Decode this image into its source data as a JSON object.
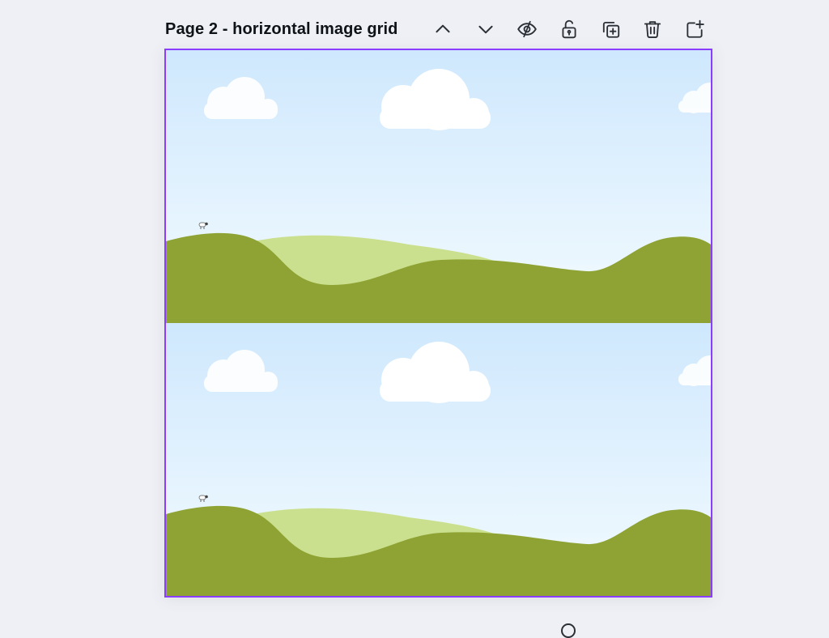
{
  "page": {
    "title": "Page 2 - horizontal image grid"
  },
  "toolbar": {
    "buttons": [
      {
        "name": "move-page-up-button",
        "icon": "chevron-up-icon"
      },
      {
        "name": "move-page-down-button",
        "icon": "chevron-down-icon"
      },
      {
        "name": "hide-page-button",
        "icon": "eye-slash-icon"
      },
      {
        "name": "lock-page-button",
        "icon": "unlock-icon"
      },
      {
        "name": "duplicate-page-button",
        "icon": "duplicate-icon"
      },
      {
        "name": "delete-page-button",
        "icon": "trash-icon"
      },
      {
        "name": "add-page-button",
        "icon": "add-page-icon"
      }
    ]
  },
  "canvas": {
    "selection_color": "#8b3dff",
    "grid_layout": "2 rows x 1 column",
    "images": [
      {
        "name": "image-top",
        "scene": "sky-clouds-green-hills"
      },
      {
        "name": "image-bottom",
        "scene": "sky-clouds-green-hills"
      }
    ],
    "colors": {
      "sky_top": "#cfe8fd",
      "sky_bottom": "#f3fbff",
      "hill_dark": "#8fa334",
      "hill_light": "#cbe08e",
      "cloud": "#ffffff"
    }
  }
}
